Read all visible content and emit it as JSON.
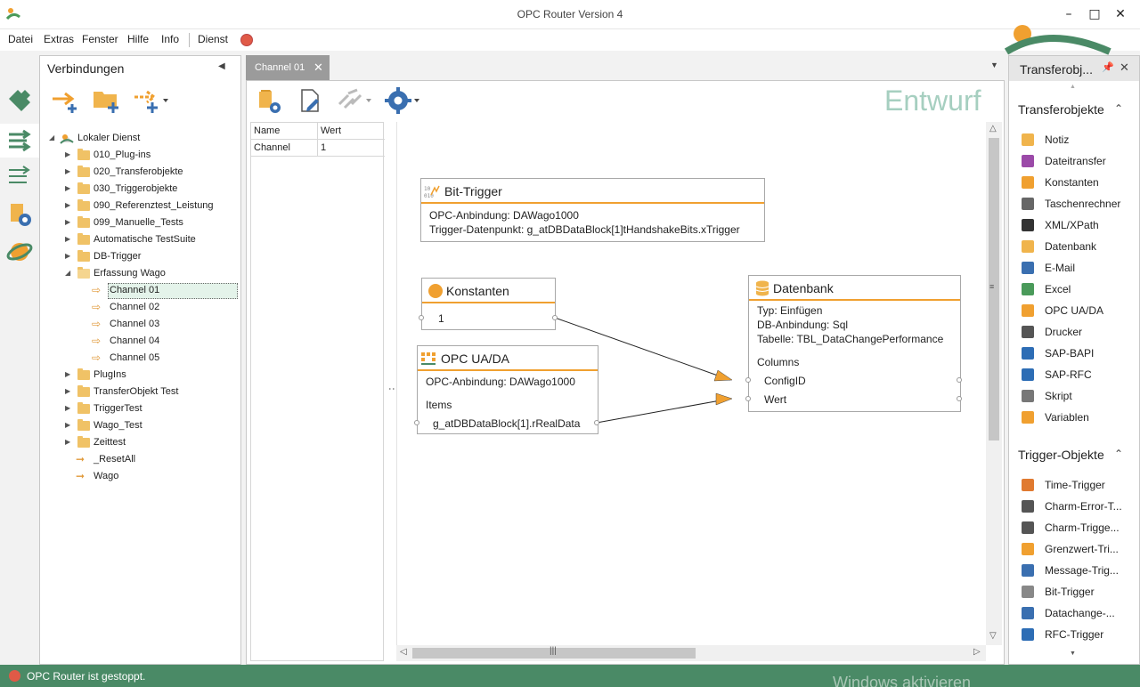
{
  "window": {
    "title": "OPC Router Version 4"
  },
  "menu": {
    "items": [
      "Datei",
      "Extras",
      "Fenster",
      "Hilfe",
      "Info",
      "Dienst"
    ]
  },
  "connections": {
    "title": "Verbindungen",
    "tree": [
      {
        "label": "Lokaler Dienst",
        "level": 0,
        "type": "root",
        "expanded": true
      },
      {
        "label": "010_Plug-ins",
        "level": 1,
        "type": "folder"
      },
      {
        "label": "020_Transferobjekte",
        "level": 1,
        "type": "folder"
      },
      {
        "label": "030_Triggerobjekte",
        "level": 1,
        "type": "folder"
      },
      {
        "label": "090_Referenztest_Leistung",
        "level": 1,
        "type": "folder"
      },
      {
        "label": "099_Manuelle_Tests",
        "level": 1,
        "type": "folder"
      },
      {
        "label": "Automatische TestSuite",
        "level": 1,
        "type": "folder"
      },
      {
        "label": "DB-Trigger",
        "level": 1,
        "type": "folder"
      },
      {
        "label": "Erfassung Wago",
        "level": 1,
        "type": "folder-open",
        "expanded": true
      },
      {
        "label": "Channel 01",
        "level": 2,
        "type": "channel",
        "selected": true
      },
      {
        "label": "Channel 02",
        "level": 2,
        "type": "channel"
      },
      {
        "label": "Channel 03",
        "level": 2,
        "type": "channel"
      },
      {
        "label": "Channel 04",
        "level": 2,
        "type": "channel"
      },
      {
        "label": "Channel 05",
        "level": 2,
        "type": "channel"
      },
      {
        "label": "PlugIns",
        "level": 1,
        "type": "folder"
      },
      {
        "label": "TransferObjekt Test",
        "level": 1,
        "type": "folder"
      },
      {
        "label": "TriggerTest",
        "level": 1,
        "type": "folder"
      },
      {
        "label": "Wago_Test",
        "level": 1,
        "type": "folder"
      },
      {
        "label": "Zeittest",
        "level": 1,
        "type": "folder"
      },
      {
        "label": "_ResetAll",
        "level": 1,
        "type": "connection"
      },
      {
        "label": "Wago",
        "level": 1,
        "type": "connection"
      }
    ]
  },
  "tab": {
    "label": "Channel 01"
  },
  "editor": {
    "mode_label": "Entwurf",
    "properties": {
      "headers": [
        "Name",
        "Wert"
      ],
      "rows": [
        [
          "Channel",
          "1"
        ]
      ]
    }
  },
  "nodes": {
    "bit_trigger": {
      "title": "Bit-Trigger",
      "line1": "OPC-Anbindung: DAWago1000",
      "line2": "Trigger-Datenpunkt: g_atDBDataBlock[1]tHandshakeBits.xTrigger"
    },
    "konstanten": {
      "title": "Konstanten",
      "value": "1"
    },
    "opc": {
      "title": "OPC UA/DA",
      "line1": "OPC-Anbindung: DAWago1000",
      "items_label": "Items",
      "item1": "g_atDBDataBlock[1].rRealData"
    },
    "datenbank": {
      "title": "Datenbank",
      "line1": "Typ: Einfügen",
      "line2": "DB-Anbindung: Sql",
      "line3": "Tabelle: TBL_DataChangePerformance",
      "columns_label": "Columns",
      "col1": "ConfigID",
      "col2": "Wert"
    }
  },
  "right_panel": {
    "title": "Transferobj...",
    "section1": "Transferobjekte",
    "transfer_items": [
      {
        "label": "Notiz",
        "icon": "note-icon",
        "color": "#f0b44c"
      },
      {
        "label": "Dateitransfer",
        "icon": "file-transfer-icon",
        "color": "#9b4aa8"
      },
      {
        "label": "Konstanten",
        "icon": "constants-icon",
        "color": "#f0a030"
      },
      {
        "label": "Taschenrechner",
        "icon": "calculator-icon",
        "color": "#666666"
      },
      {
        "label": "XML/XPath",
        "icon": "xml-icon",
        "color": "#333333"
      },
      {
        "label": "Datenbank",
        "icon": "database-icon",
        "color": "#f0b44c"
      },
      {
        "label": "E-Mail",
        "icon": "email-icon",
        "color": "#3a6fb0"
      },
      {
        "label": "Excel",
        "icon": "excel-icon",
        "color": "#4a9a5a"
      },
      {
        "label": "OPC UA/DA",
        "icon": "opc-icon",
        "color": "#f0a030"
      },
      {
        "label": "Drucker",
        "icon": "printer-icon",
        "color": "#555555"
      },
      {
        "label": "SAP-BAPI",
        "icon": "sap-bapi-icon",
        "color": "#2d6db5"
      },
      {
        "label": "SAP-RFC",
        "icon": "sap-rfc-icon",
        "color": "#2d6db5"
      },
      {
        "label": "Skript",
        "icon": "script-icon",
        "color": "#777777"
      },
      {
        "label": "Variablen",
        "icon": "variables-icon",
        "color": "#f0a030"
      }
    ],
    "section2": "Trigger-Objekte",
    "trigger_items": [
      {
        "label": "Time-Trigger",
        "icon": "time-trigger-icon",
        "color": "#e07a30"
      },
      {
        "label": "Charm-Error-T...",
        "icon": "charm-error-icon",
        "color": "#555555"
      },
      {
        "label": "Charm-Trigge...",
        "icon": "charm-trigger-icon",
        "color": "#555555"
      },
      {
        "label": "Grenzwert-Tri...",
        "icon": "threshold-trigger-icon",
        "color": "#f0a030"
      },
      {
        "label": "Message-Trig...",
        "icon": "message-trigger-icon",
        "color": "#3a6fb0"
      },
      {
        "label": "Bit-Trigger",
        "icon": "bit-trigger-icon",
        "color": "#888888"
      },
      {
        "label": "Datachange-...",
        "icon": "datachange-trigger-icon",
        "color": "#3a6fb0"
      },
      {
        "label": "RFC-Trigger",
        "icon": "rfc-trigger-icon",
        "color": "#2d6db5"
      }
    ]
  },
  "status": {
    "text": "OPC Router ist gestoppt.",
    "watermark": "Windows aktivieren"
  },
  "colors": {
    "status_bar": "#4a8a66",
    "accent_orange": "#f0a030",
    "stopped_red": "#e05a47"
  }
}
